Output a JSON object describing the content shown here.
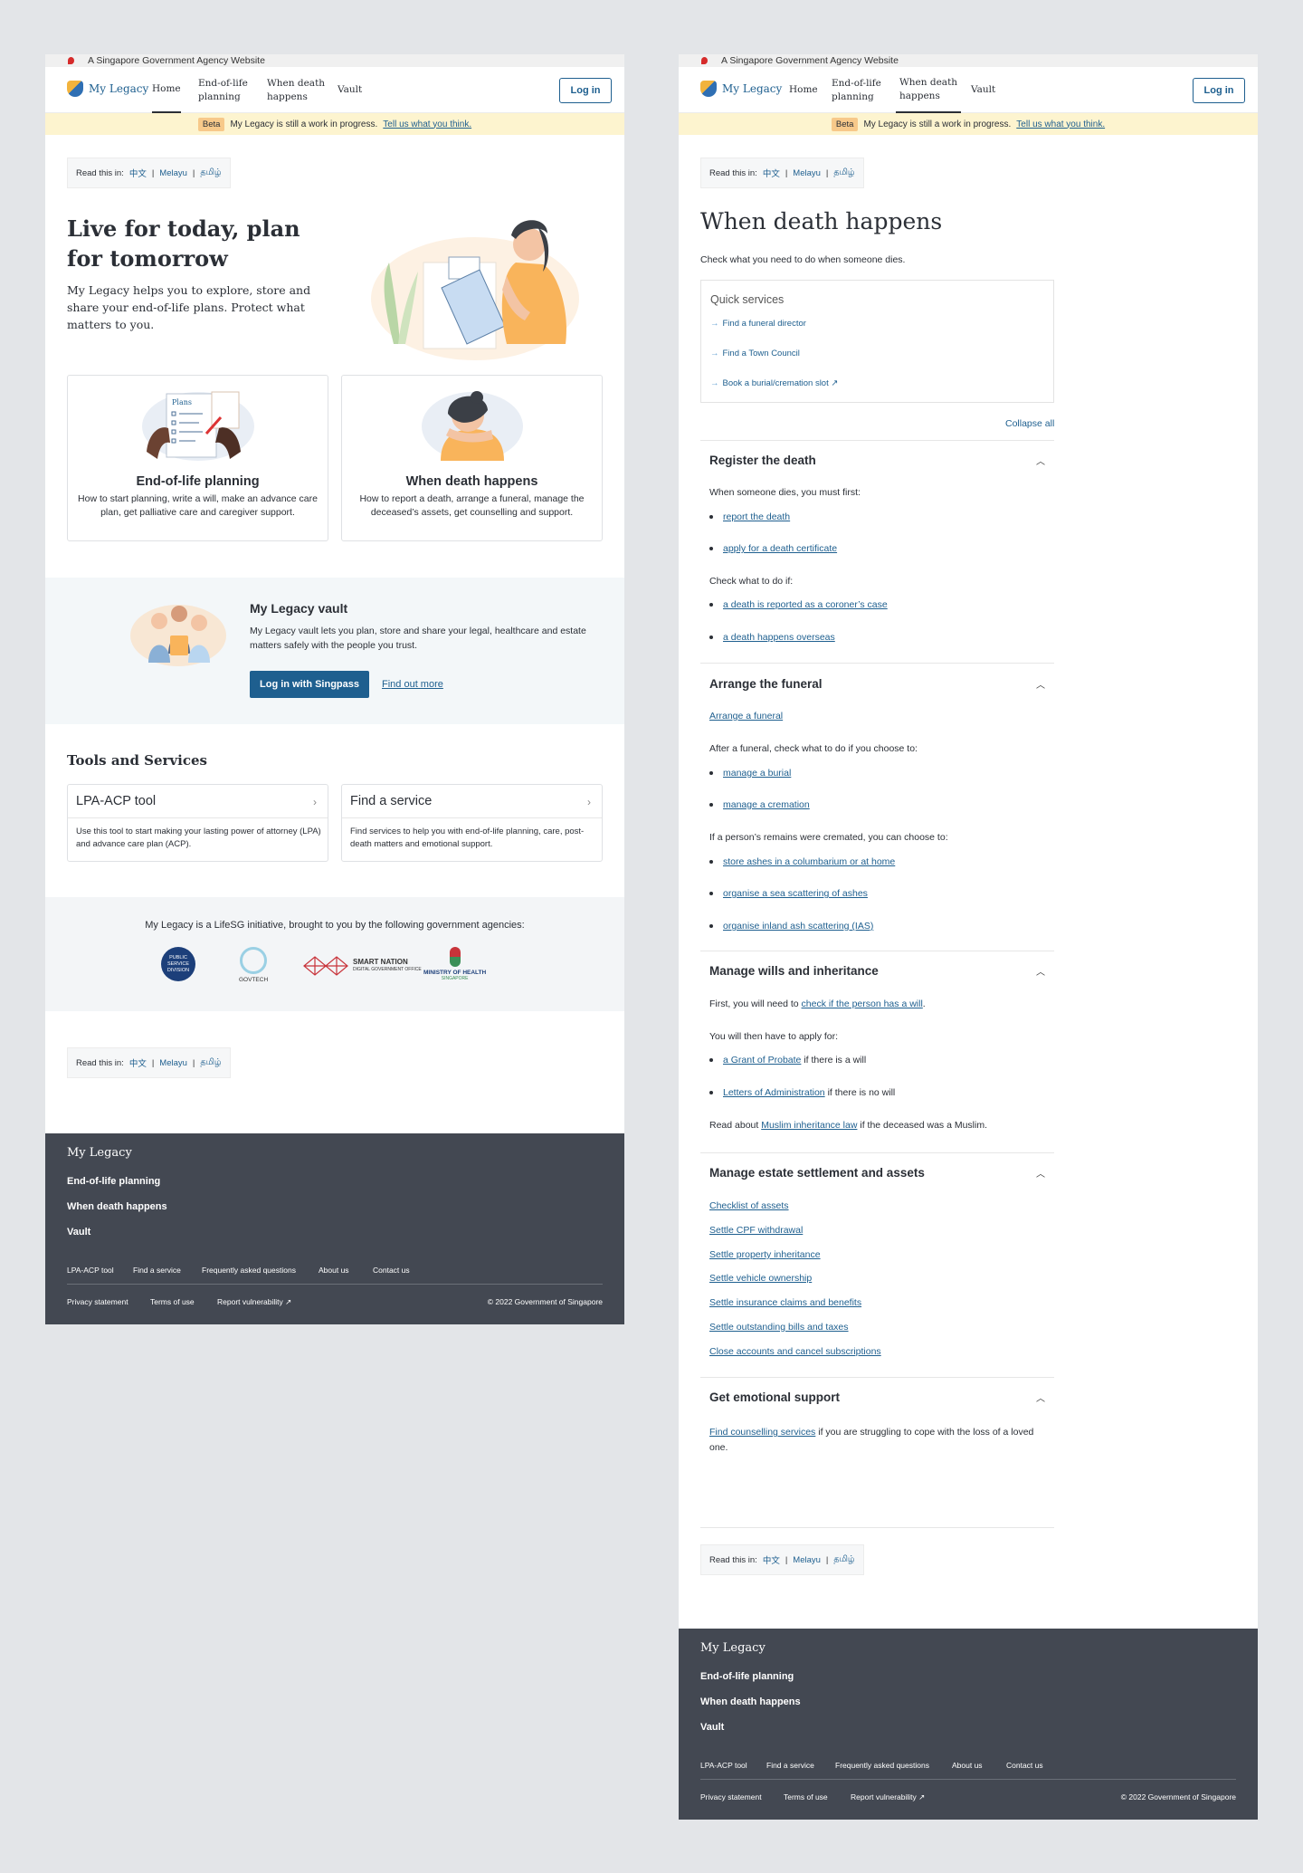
{
  "gov_banner": "A Singapore Government Agency Website",
  "brand": "My Legacy",
  "nav": {
    "home": "Home",
    "eol": [
      "End-of-life",
      "planning"
    ],
    "wdh": [
      "When death",
      "happens"
    ],
    "vault": "Vault",
    "login": "Log in"
  },
  "beta": {
    "tag": "Beta",
    "text": "My Legacy is still a work in progress.",
    "link": "Tell us what you think."
  },
  "readthis": {
    "label": "Read this in:",
    "zh": "中文",
    "ms": "Melayu",
    "ta": "தமிழ்",
    "sep": "|"
  },
  "home": {
    "hero_title": "Live for today, plan for tomorrow",
    "hero_text": "My Legacy helps you to explore, store and share your end-of-life plans. Protect what matters to you.",
    "card1_title": "End-of-life planning",
    "card1_text": "How to start planning, write a will, make an advance care plan, get palliative care and caregiver support.",
    "card2_title": "When death happens",
    "card2_text": "How to report a death, arrange a funeral, manage the deceased’s assets, get counselling and support.",
    "illus_paper_text": "Plans",
    "vault_title": "My Legacy vault",
    "vault_text": "My Legacy vault lets you plan, store and share your legal, healthcare and estate matters safely with the people you trust.",
    "vault_button": "Log in with Singpass",
    "vault_link": "Find out more",
    "tools_title": "Tools and Services",
    "tool1_title": "LPA-ACP tool",
    "tool1_text": "Use this tool to start making your lasting power of attorney (LPA) and advance care plan (ACP).",
    "tool2_title": "Find a service",
    "tool2_text": "Find services to help you with end-of-life planning, care, post-death matters and emotional support.",
    "partners_text": "My Legacy is a LifeSG initiative, brought to you by the following government agencies:",
    "partner1": "PUBLIC SERVICE DIVISION",
    "partner2": "GOVTECH",
    "partner3_name": "SMART NATION",
    "partner3_sub": "DIGITAL GOVERNMENT OFFICE",
    "partner4": "MINISTRY OF HEALTH",
    "partner4_sub": "SINGAPORE"
  },
  "wdh": {
    "title": "When death happens",
    "subtitle": "Check what you need to do when someone dies.",
    "quick_title": "Quick services",
    "quick": [
      "Find a funeral director",
      "Find a Town Council",
      "Book a burial/cremation slot"
    ],
    "collapse_all": "Collapse all",
    "s1": {
      "title": "Register the death",
      "intro": "When someone dies, you must first:",
      "b1": "report the death",
      "b2": "apply for a death certificate",
      "check": "Check what to do if:",
      "b3": "a death is reported as a coroner’s case",
      "b4": "a death happens overseas"
    },
    "s2": {
      "title": "Arrange the funeral",
      "link": "Arrange a funeral",
      "after": "After a funeral, check what to do if you choose to:",
      "b1": "manage a burial",
      "b2": "manage a cremation",
      "cremated": "If a person’s remains were cremated, you can choose to:",
      "b3": "store ashes in a columbarium or at home",
      "b4": "organise a sea scattering of ashes",
      "b5": "organise inland ash scattering (IAS)"
    },
    "s3": {
      "title": "Manage wills and inheritance",
      "first_pre": "First, you will need to",
      "first_link": "check if the person has a will",
      "first_post": ".",
      "then": "You will then have to apply for:",
      "b1_link": "a Grant of Probate",
      "b1_text": "if there is a will",
      "b2_link": "Letters of Administration",
      "b2_text": "if there is no will",
      "read_pre": "Read about",
      "read_link": "Muslim inheritance law",
      "read_post": "if the deceased was a Muslim."
    },
    "s4": {
      "title": "Manage estate settlement and assets",
      "links": [
        "Checklist of assets",
        "Settle CPF withdrawal",
        "Settle property inheritance",
        "Settle vehicle ownership",
        "Settle insurance claims and benefits",
        "Settle outstanding bills and taxes",
        "Close accounts and cancel subscriptions"
      ]
    },
    "s5": {
      "title": "Get emotional support",
      "link": "Find counselling services",
      "text": "if you are struggling to cope with the loss of a loved one."
    }
  },
  "footer": {
    "brand": "My Legacy",
    "links": [
      "End-of-life planning",
      "When death happens",
      "Vault"
    ],
    "small": [
      "LPA-ACP tool",
      "Find a service",
      "Frequently asked questions",
      "About us",
      "Contact us"
    ],
    "privacy": "Privacy statement",
    "terms": "Terms of use",
    "vuln": "Report vulnerability",
    "copyright": "© 2022 Government of Singapore"
  }
}
